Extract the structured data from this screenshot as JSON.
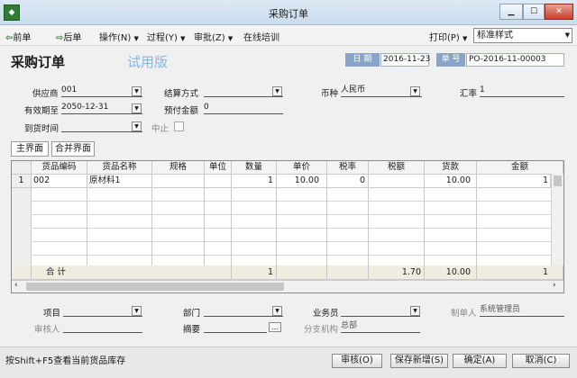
{
  "window": {
    "title": "采购订单"
  },
  "toolbar": {
    "prev": "前单",
    "next": "后单",
    "operation": "操作(N)",
    "process": "过程(Y)",
    "approve": "审批(Z)",
    "training": "在线培训",
    "print": "打印(P)",
    "style": "标准样式"
  },
  "header": {
    "title": "采购订单",
    "trial": "试用版",
    "date_label": "日 期",
    "date_value": "2016-11-23",
    "no_label": "单 号",
    "no_value": "PO-2016-11-00003"
  },
  "form": {
    "supplier_label": "供应商",
    "supplier_value": "001",
    "settle_label": "结算方式",
    "settle_value": "",
    "currency_label": "币种",
    "currency_value": "人民币",
    "rate_label": "汇率",
    "rate_value": "1",
    "expiry_label": "有效期至",
    "expiry_value": "2050-12-31",
    "prepay_label": "预付金额",
    "prepay_value": "0",
    "arrival_label": "到货时间",
    "arrival_value": "",
    "suspend_label": "中止"
  },
  "tabs": {
    "main": "主界面",
    "merge": "合并界面"
  },
  "table": {
    "columns": [
      "货品编码",
      "货品名称",
      "规格",
      "单位",
      "数量",
      "单价",
      "税率",
      "税额",
      "货款",
      "金额"
    ],
    "row": {
      "num": "1",
      "code": "002",
      "name": "原材料1",
      "spec": "",
      "unit": "",
      "qty": "1",
      "price": "10.00",
      "taxrate": "0",
      "tax": "",
      "goods": "10.00",
      "amount": "1"
    },
    "total": {
      "label": "合 计",
      "qty": "1",
      "tax": "1.70",
      "goods": "10.00",
      "amount": "1"
    }
  },
  "footer_form": {
    "project_label": "项目",
    "project_value": "",
    "dept_label": "部门",
    "dept_value": "",
    "staff_label": "业务员",
    "staff_value": "",
    "maker_label": "制单人",
    "maker_value": "系统管理员",
    "auditor_label": "审核人",
    "auditor_value": "",
    "summary_label": "摘要",
    "summary_value": "",
    "branch_label": "分支机构",
    "branch_value": "总部"
  },
  "status": {
    "hint": "按Shift+F5查看当前货品库存"
  },
  "buttons": {
    "audit": "审核(O)",
    "save_new": "保存新增(S)",
    "ok": "确定(A)",
    "cancel": "取消(C)"
  },
  "colors": {
    "label_box": "#88a5c8",
    "trial": "#8ab6de",
    "accent_green": "#2e7d32"
  }
}
